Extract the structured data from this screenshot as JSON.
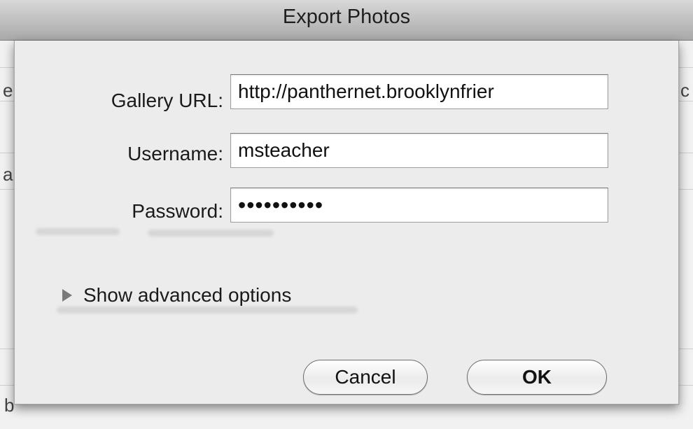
{
  "window": {
    "title": "Export Photos"
  },
  "backdrop": {
    "glyphs": [
      "e",
      "a",
      "b"
    ],
    "right_glyph": "c"
  },
  "form": {
    "gallery_url": {
      "label": "Gallery URL:",
      "value": "http://panthernet.brooklynfrier"
    },
    "username": {
      "label": "Username:",
      "value": "msteacher"
    },
    "password": {
      "label": "Password:",
      "value": "••••••••••"
    }
  },
  "advanced": {
    "label": "Show advanced options",
    "icon": "disclosure-triangle-right"
  },
  "buttons": {
    "cancel": "Cancel",
    "ok": "OK"
  }
}
